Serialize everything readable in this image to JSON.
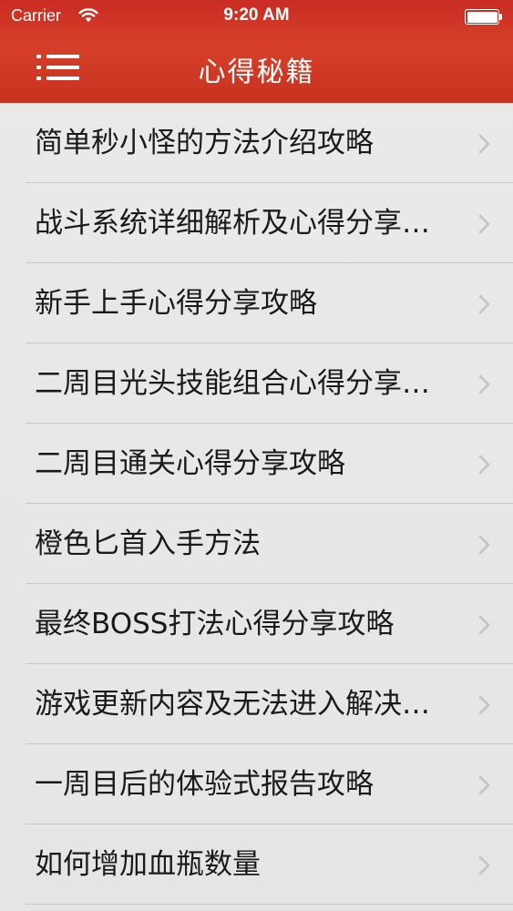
{
  "status_bar": {
    "carrier": "Carrier",
    "time": "9:20 AM",
    "icons": {
      "wifi": "wifi-icon",
      "battery": "battery-icon"
    },
    "battery_level": 1.0
  },
  "nav": {
    "title": "心得秘籍",
    "menu_icon": "hamburger-menu-icon"
  },
  "colors": {
    "nav_background": "#cd3524",
    "list_background": "#e9e8e6",
    "text": "#1a1a1a",
    "separator": "#c9c8c6",
    "chevron": "#c4c3c1"
  },
  "list": {
    "chevron_icon": "chevron-right-icon",
    "items": [
      {
        "label": "简单秒小怪的方法介绍攻略"
      },
      {
        "label": "战斗系统详细解析及心得分享…"
      },
      {
        "label": "新手上手心得分享攻略"
      },
      {
        "label": "二周目光头技能组合心得分享…"
      },
      {
        "label": "二周目通关心得分享攻略"
      },
      {
        "label": "橙色匕首入手方法"
      },
      {
        "label": "最终BOSS打法心得分享攻略"
      },
      {
        "label": "游戏更新内容及无法进入解决…"
      },
      {
        "label": "一周目后的体验式报告攻略"
      },
      {
        "label": "如何增加血瓶数量"
      }
    ]
  }
}
